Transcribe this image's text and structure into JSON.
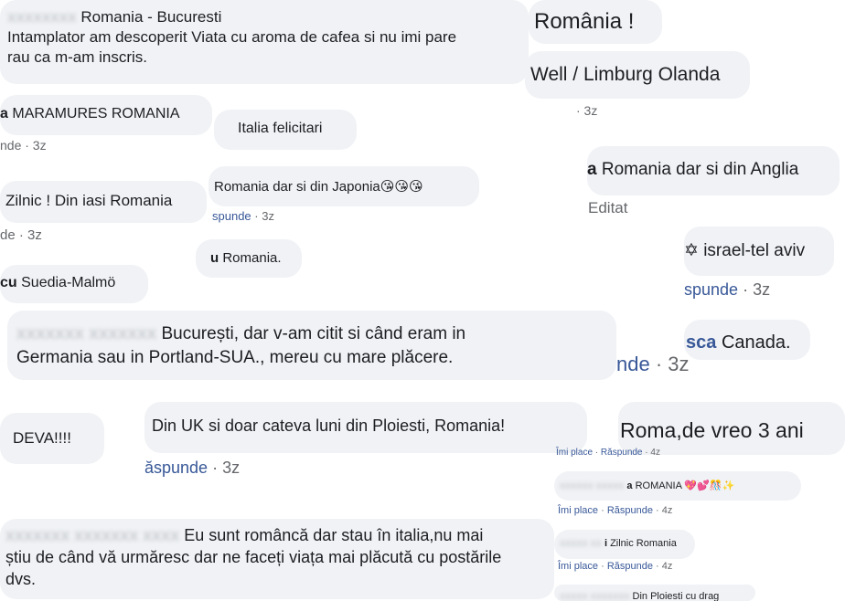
{
  "comments": [
    {
      "name_fragment": "",
      "text": "Romania - Bucuresti"
    },
    {
      "text_line1": "Intamplator am descoperit Viata cu aroma de cafea si nu imi pare",
      "text_line2": "rau ca m-am inscris."
    },
    {
      "name_fragment": "a",
      "text": "MARAMURES ROMANIA"
    },
    {
      "name_fragment": "",
      "text": "Italia felicitari"
    },
    {
      "text": "Zilnic ! Din iasi Romania"
    },
    {
      "text": "Romania dar si din Japonia",
      "emoji": "😘😘😘"
    },
    {
      "name_fragment": "u",
      "text": "Romania."
    },
    {
      "name_fragment": "cu",
      "text": "Suedia-Malmö"
    },
    {
      "text_line1": "București, dar v-am citit si când eram in",
      "text_line2": "Germania sau in Portland-SUA., mereu cu mare plăcere."
    },
    {
      "text": "DEVA!!!!"
    },
    {
      "text": "Din UK si doar cateva luni din Ploiesti, Romania!"
    },
    {
      "text_line1": "Eu sunt româncă dar stau în italia,nu mai",
      "text_line2": "știu de când vă urmăresc dar ne faceți viața mai plăcută cu postările",
      "text_line3": "dvs."
    },
    {
      "text": "România !"
    },
    {
      "text": "Well / Limburg Olanda"
    },
    {
      "name_fragment": "a",
      "text": "Romania dar si din Anglia"
    },
    {
      "text": "israel-tel aviv"
    },
    {
      "name_fragment": "sca",
      "text": "Canada."
    },
    {
      "text": "Roma,de vreo 3 ani"
    },
    {
      "name_fragment": "a",
      "text": "ROMANIA",
      "emoji": "💖💕🎊✨"
    },
    {
      "name_fragment": "i",
      "text": "Zilnic Romania"
    },
    {
      "text": "Din Ploiesti cu drag"
    }
  ],
  "meta": [
    {
      "reply": "nde",
      "time": "· 3z"
    },
    {
      "reply": "de",
      "time": "· 3z"
    },
    {
      "reply": "spunde",
      "time": "· 3z"
    },
    {
      "reply": "ăspunde",
      "time": "· 3z"
    },
    {
      "time": "· 3z"
    },
    {
      "edited": "Editat"
    },
    {
      "reply": "spunde",
      "time": "· 3z"
    },
    {
      "reply": "nde",
      "time": "· 3z"
    },
    {
      "like": "Îmi place",
      "reply": "Răspunde",
      "time": "· 4z"
    },
    {
      "like": "Îmi place",
      "reply": "Răspunde",
      "time": "· 4z"
    },
    {
      "like": "Îmi place",
      "reply": "Răspunde",
      "time": "· 4z"
    }
  ],
  "icons": {
    "israel_flag": "✡"
  }
}
